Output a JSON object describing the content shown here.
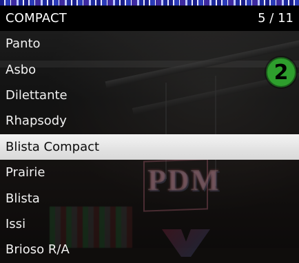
{
  "menu": {
    "title": "COMPACT",
    "counter": "5 / 11",
    "items": [
      {
        "label": "Panto"
      },
      {
        "label": "Asbo"
      },
      {
        "label": "Dilettante"
      },
      {
        "label": "Rhapsody"
      },
      {
        "label": "Blista Compact"
      },
      {
        "label": "Prairie"
      },
      {
        "label": "Blista"
      },
      {
        "label": "Issi"
      },
      {
        "label": "Brioso R/A"
      }
    ],
    "selected_index": 4
  },
  "badge": {
    "text": "2",
    "color": "#2e9e2d"
  },
  "scene": {
    "sign_text": "PDM"
  },
  "icons": {
    "badge_icon": "number-badge-icon"
  }
}
